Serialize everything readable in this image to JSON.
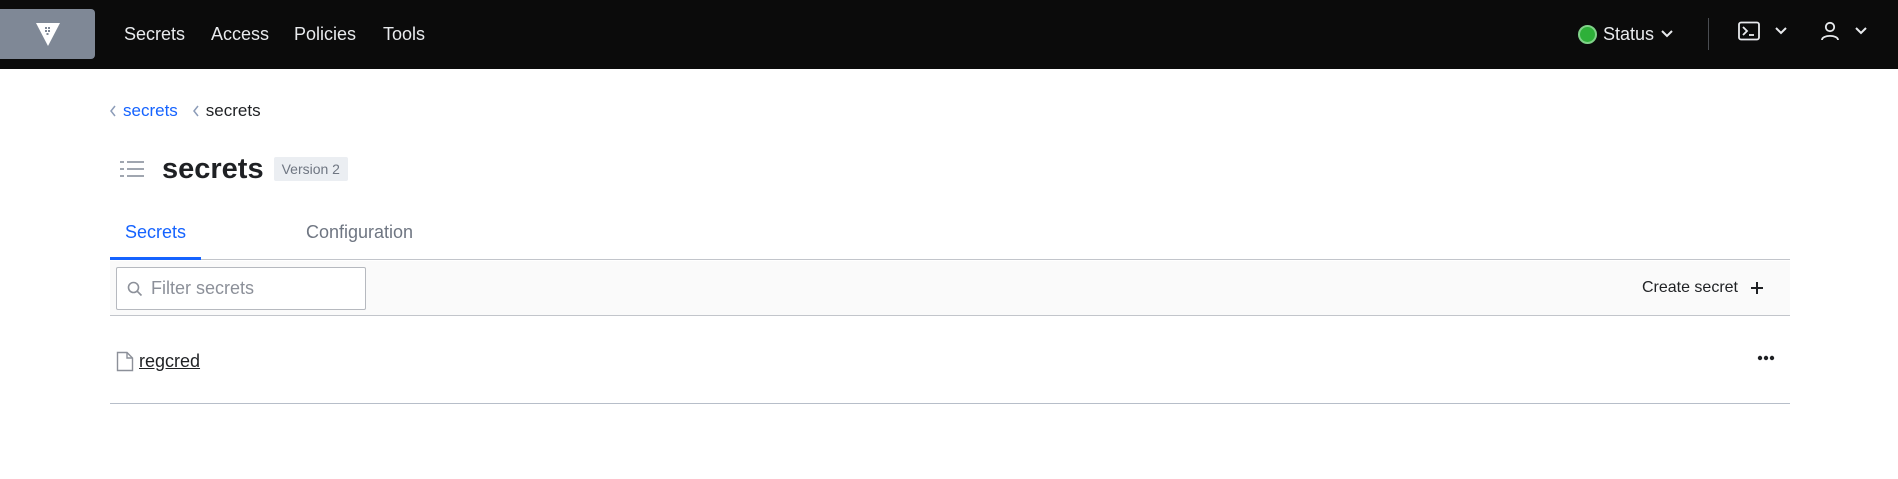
{
  "nav": {
    "links": [
      "Secrets",
      "Access",
      "Policies",
      "Tools"
    ],
    "status_label": "Status",
    "status_color": "#2eb039",
    "logo_icon": "vault-logo-icon",
    "console_icon": "terminal-icon",
    "user_icon": "user-icon"
  },
  "breadcrumb": {
    "items": [
      "secrets",
      "secrets"
    ]
  },
  "header": {
    "title": "secrets",
    "version_badge": "Version 2",
    "icon": "list-icon"
  },
  "tabs": {
    "items": [
      "Secrets",
      "Configuration"
    ],
    "active": "Secrets"
  },
  "toolbar": {
    "filter_placeholder": "Filter secrets",
    "filter_value": "",
    "create_label": "Create secret"
  },
  "secrets": {
    "items": [
      {
        "name": "regcred",
        "icon": "file-icon"
      }
    ]
  },
  "colors": {
    "accent": "#1563ff",
    "topbar": "#0b0b0b"
  }
}
